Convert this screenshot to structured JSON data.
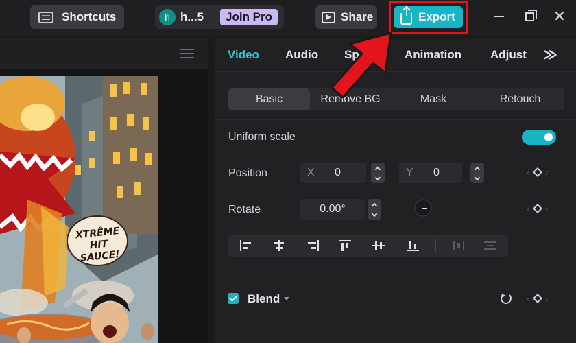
{
  "topbar": {
    "shortcuts_label": "Shortcuts",
    "user_initial": "h",
    "user_name": "h...5",
    "join_pro_label": "Join Pro",
    "share_label": "Share",
    "export_label": "Export",
    "highlight_color": "#e4141d",
    "accent_color": "#17b6c4"
  },
  "preview": {
    "overlay_text_lines": [
      "XTRÊME",
      "HIT",
      "SAUCE!"
    ]
  },
  "panel": {
    "tabs": [
      {
        "label": "Video",
        "active": true
      },
      {
        "label": "Audio",
        "active": false
      },
      {
        "label": "Spe",
        "active": false
      },
      {
        "label": "Animation",
        "active": false
      },
      {
        "label": "Adjust",
        "active": false
      }
    ],
    "more_label": "≫",
    "subtabs": [
      {
        "label": "Basic",
        "active": true
      },
      {
        "label": "Remove BG",
        "active": false
      },
      {
        "label": "Mask",
        "active": false
      },
      {
        "label": "Retouch",
        "active": false
      }
    ],
    "uniform_scale": {
      "label": "Uniform scale",
      "enabled": true
    },
    "position": {
      "label": "Position",
      "x_axis": "X",
      "x_value": "0",
      "y_axis": "Y",
      "y_value": "0"
    },
    "rotate": {
      "label": "Rotate",
      "value": "0.00°"
    },
    "blend": {
      "label": "Blend",
      "checked": true
    }
  }
}
